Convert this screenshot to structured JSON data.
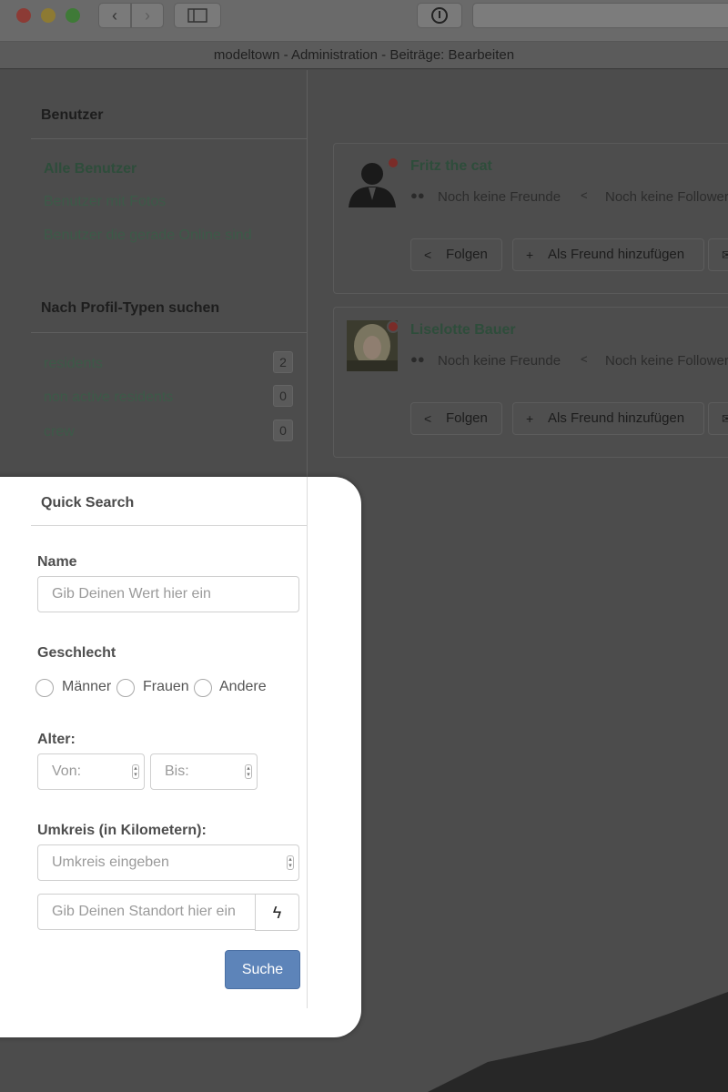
{
  "window": {
    "title": "modeltown - Administration - Beiträge: Bearbeiten",
    "nav_back_icon": "chevron-left-icon",
    "nav_forward_icon": "chevron-right-icon",
    "sidebar_toggle_icon": "sidebar-icon",
    "info_icon": "info-icon"
  },
  "sidebar": {
    "users_title": "Benutzer",
    "links": [
      {
        "label": "Alle Benutzer",
        "active": true
      },
      {
        "label": "Benutzer mit Fotos",
        "active": false
      },
      {
        "label": "Benutzer die gerade Online sind",
        "active": false
      }
    ],
    "profile_types_title": "Nach Profil-Typen suchen",
    "profile_types": [
      {
        "label": "residents",
        "count": "2"
      },
      {
        "label": "non active residents",
        "count": "0"
      },
      {
        "label": "crew",
        "count": "0"
      }
    ]
  },
  "users": [
    {
      "name": "Fritz the cat",
      "avatar": "silhouette",
      "friends": "Noch keine Freunde",
      "followers": "Noch keine Follower",
      "follow_label": "Folgen",
      "add_friend_label": "Als Freund hinzufügen"
    },
    {
      "name": "Liselotte Bauer",
      "avatar": "photo",
      "friends": "Noch keine Freunde",
      "followers": "Noch keine Follower",
      "follow_label": "Folgen",
      "add_friend_label": "Als Freund hinzufügen"
    }
  ],
  "quick_search": {
    "title": "Quick Search",
    "name_label": "Name",
    "name_placeholder": "Gib Deinen Wert hier ein",
    "gender_label": "Geschlecht",
    "gender_options": [
      "Männer",
      "Frauen",
      "Andere"
    ],
    "age_label": "Alter:",
    "age_from_placeholder": "Von:",
    "age_to_placeholder": "Bis:",
    "radius_label": "Umkreis (in Kilometern):",
    "radius_placeholder": "Umkreis eingeben",
    "location_placeholder": "Gib Deinen Standort hier ein",
    "search_button": "Suche"
  },
  "colors": {
    "accent": "#5d84b9",
    "link": "#3c5a48",
    "online_dot": "#d9534f"
  }
}
